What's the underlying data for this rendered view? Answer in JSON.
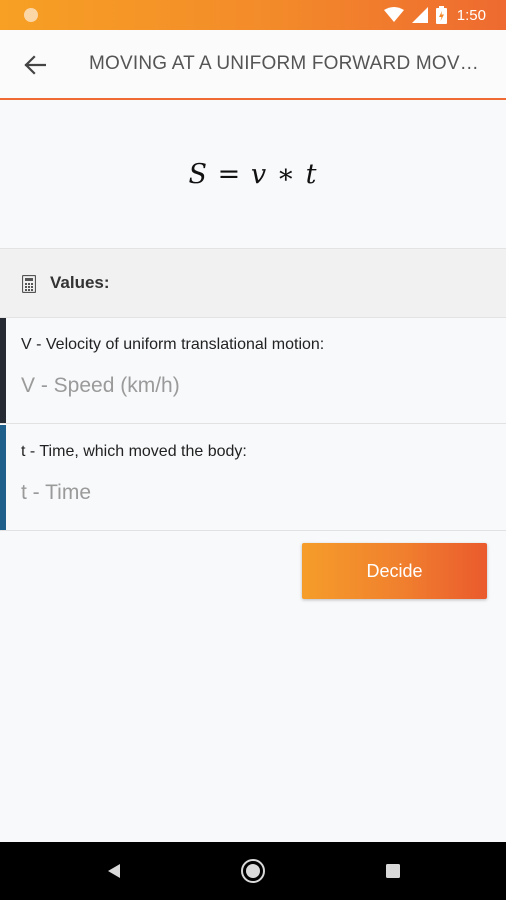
{
  "status_bar": {
    "time": "1:50",
    "icons": [
      "notification-dot-icon",
      "wifi-icon",
      "signal-icon",
      "battery-icon"
    ]
  },
  "app_bar": {
    "back_icon": "arrow-left-icon",
    "title": "MOVING AT A UNIFORM FORWARD MOVEM…",
    "accent_color": "#ef6b33"
  },
  "formula": "S = v ∗ t",
  "values_section": {
    "icon": "calculator-icon",
    "title": "Values:"
  },
  "fields": [
    {
      "label": "V - Velocity of uniform translational motion:",
      "placeholder": "V - Speed (km/h)",
      "value": "",
      "accent_color": "#252a33"
    },
    {
      "label": "t - Time, which moved the body:",
      "placeholder": "t - Time",
      "value": "",
      "accent_color": "#1f5f8b"
    }
  ],
  "decide_button": {
    "label": "Decide",
    "colors": [
      "#f59d2a",
      "#ea5a2d"
    ]
  },
  "nav_bar": {
    "icons": [
      "back-triangle-icon",
      "home-circle-icon",
      "recents-square-icon"
    ]
  }
}
